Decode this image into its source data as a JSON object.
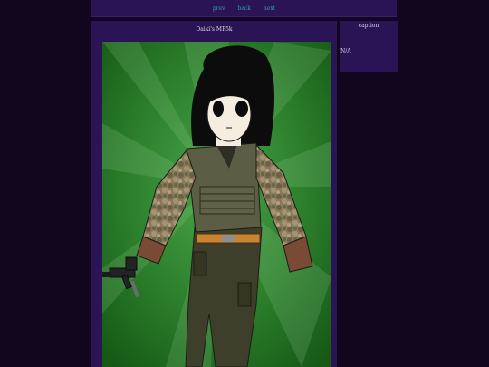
{
  "nav": {
    "prev": "prev",
    "back": "back",
    "next": "next"
  },
  "artwork": {
    "title": "Daiki's MP5k"
  },
  "sidebar": {
    "heading": "caption",
    "caption_text": "N/A"
  },
  "colors": {
    "background": "#12061f",
    "panel": "#2b1456",
    "link": "#2aa3a8",
    "art_bg": "#1f6a1f"
  }
}
